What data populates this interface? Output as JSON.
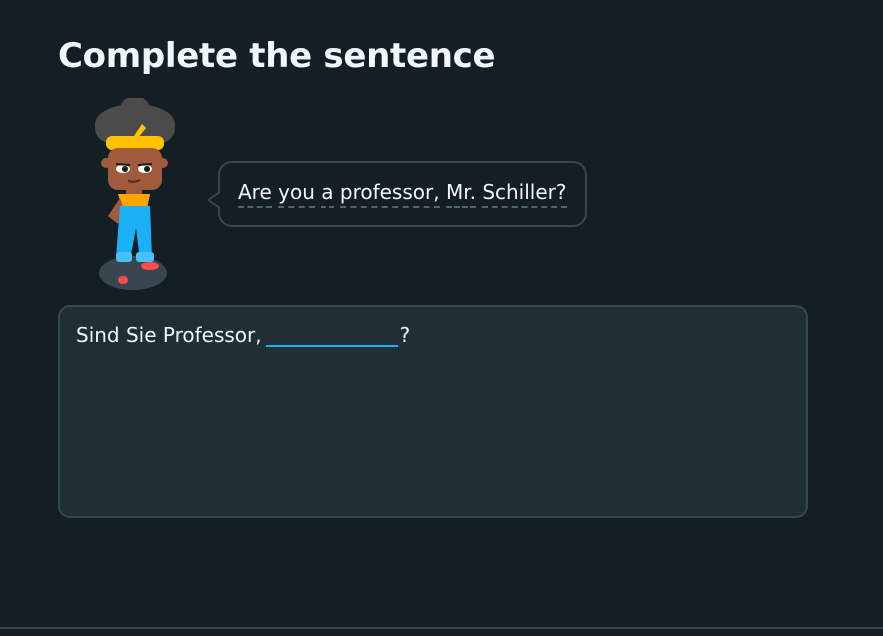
{
  "header": {
    "title": "Complete the sentence"
  },
  "prompt": {
    "character": "character-icon",
    "words": [
      "Are",
      " ",
      "you",
      " ",
      "a",
      " ",
      "professor,",
      " ",
      "Mr.",
      " ",
      "Schiller?"
    ]
  },
  "answer": {
    "prefix": "Sind Sie Professor,",
    "blank_value": "",
    "suffix": "?"
  },
  "colors": {
    "background": "#131f24",
    "panel": "#202f36",
    "border": "#37464f",
    "accent_blank": "#1cb0f6",
    "text": "#f1f7fb"
  }
}
